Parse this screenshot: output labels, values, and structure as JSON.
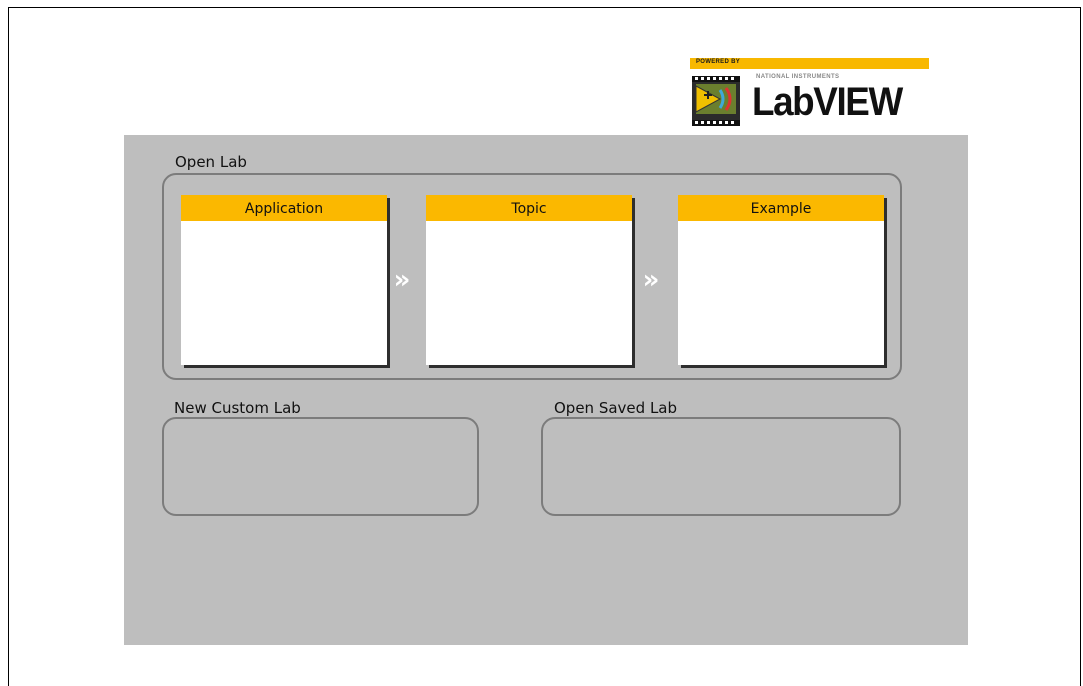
{
  "logo": {
    "powered_by": "POWERED BY",
    "vendor": "NATIONAL INSTRUMENTS",
    "product": "LabVIEW"
  },
  "open_lab": {
    "label": "Open Lab",
    "lists": [
      {
        "header": "Application"
      },
      {
        "header": "Topic"
      },
      {
        "header": "Example"
      }
    ],
    "arrow_glyph": "»"
  },
  "new_custom_lab": {
    "label": "New Custom Lab"
  },
  "open_saved_lab": {
    "label": "Open Saved Lab"
  },
  "colors": {
    "accent": "#fbb800",
    "panel": "#bebebe",
    "border": "#7c7c7c"
  }
}
